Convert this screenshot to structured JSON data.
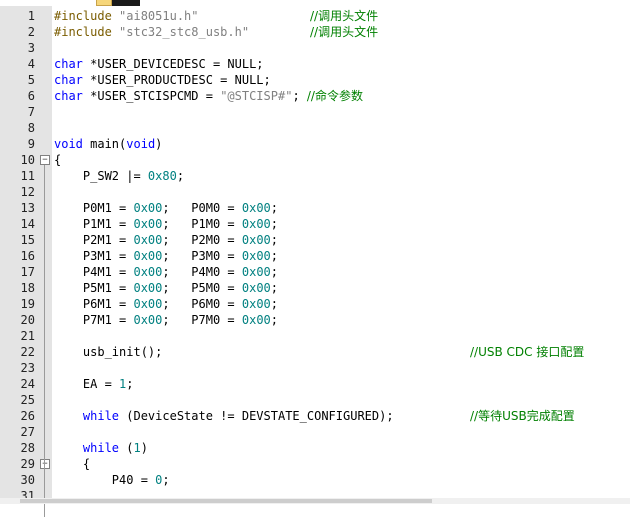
{
  "lines": [
    {
      "n": "1",
      "code": "",
      "parts": [
        {
          "t": "#include ",
          "c": "pp"
        },
        {
          "t": "\"ai8051u.h\"",
          "c": "str"
        }
      ],
      "comment": "//调用头文件"
    },
    {
      "n": "2",
      "code": "",
      "parts": [
        {
          "t": "#include ",
          "c": "pp"
        },
        {
          "t": "\"stc32_stc8_usb.h\"",
          "c": "str"
        }
      ],
      "comment": "//调用头文件"
    },
    {
      "n": "3",
      "parts": []
    },
    {
      "n": "4",
      "parts": [
        {
          "t": "char",
          "c": "kw"
        },
        {
          "t": " *USER_DEVICEDESC = NULL;",
          "c": ""
        }
      ]
    },
    {
      "n": "5",
      "parts": [
        {
          "t": "char",
          "c": "kw"
        },
        {
          "t": " *USER_PRODUCTDESC = NULL;",
          "c": ""
        }
      ]
    },
    {
      "n": "6",
      "parts": [
        {
          "t": "char",
          "c": "kw"
        },
        {
          "t": " *USER_STCISPCMD = ",
          "c": ""
        },
        {
          "t": "\"@STCISP#\"",
          "c": "str"
        },
        {
          "t": "; ",
          "c": ""
        },
        {
          "t": "//命令参数",
          "c": "cmt"
        }
      ]
    },
    {
      "n": "7",
      "parts": []
    },
    {
      "n": "8",
      "parts": []
    },
    {
      "n": "9",
      "parts": [
        {
          "t": "void",
          "c": "kw"
        },
        {
          "t": " main(",
          "c": ""
        },
        {
          "t": "void",
          "c": "kw"
        },
        {
          "t": ")",
          "c": ""
        }
      ]
    },
    {
      "n": "10",
      "fold": "−",
      "parts": [
        {
          "t": "{",
          "c": ""
        }
      ]
    },
    {
      "n": "11",
      "parts": [
        {
          "t": "    P_SW2 |= ",
          "c": ""
        },
        {
          "t": "0x80",
          "c": "num"
        },
        {
          "t": ";",
          "c": ""
        }
      ]
    },
    {
      "n": "12",
      "parts": []
    },
    {
      "n": "13",
      "parts": [
        {
          "t": "    P0M1 = ",
          "c": ""
        },
        {
          "t": "0x00",
          "c": "num"
        },
        {
          "t": ";   P0M0 = ",
          "c": ""
        },
        {
          "t": "0x00",
          "c": "num"
        },
        {
          "t": ";",
          "c": ""
        }
      ]
    },
    {
      "n": "14",
      "parts": [
        {
          "t": "    P1M1 = ",
          "c": ""
        },
        {
          "t": "0x00",
          "c": "num"
        },
        {
          "t": ";   P1M0 = ",
          "c": ""
        },
        {
          "t": "0x00",
          "c": "num"
        },
        {
          "t": ";",
          "c": ""
        }
      ]
    },
    {
      "n": "15",
      "parts": [
        {
          "t": "    P2M1 = ",
          "c": ""
        },
        {
          "t": "0x00",
          "c": "num"
        },
        {
          "t": ";   P2M0 = ",
          "c": ""
        },
        {
          "t": "0x00",
          "c": "num"
        },
        {
          "t": ";",
          "c": ""
        }
      ]
    },
    {
      "n": "16",
      "parts": [
        {
          "t": "    P3M1 = ",
          "c": ""
        },
        {
          "t": "0x00",
          "c": "num"
        },
        {
          "t": ";   P3M0 = ",
          "c": ""
        },
        {
          "t": "0x00",
          "c": "num"
        },
        {
          "t": ";",
          "c": ""
        }
      ]
    },
    {
      "n": "17",
      "parts": [
        {
          "t": "    P4M1 = ",
          "c": ""
        },
        {
          "t": "0x00",
          "c": "num"
        },
        {
          "t": ";   P4M0 = ",
          "c": ""
        },
        {
          "t": "0x00",
          "c": "num"
        },
        {
          "t": ";",
          "c": ""
        }
      ]
    },
    {
      "n": "18",
      "parts": [
        {
          "t": "    P5M1 = ",
          "c": ""
        },
        {
          "t": "0x00",
          "c": "num"
        },
        {
          "t": ";   P5M0 = ",
          "c": ""
        },
        {
          "t": "0x00",
          "c": "num"
        },
        {
          "t": ";",
          "c": ""
        }
      ]
    },
    {
      "n": "19",
      "parts": [
        {
          "t": "    P6M1 = ",
          "c": ""
        },
        {
          "t": "0x00",
          "c": "num"
        },
        {
          "t": ";   P6M0 = ",
          "c": ""
        },
        {
          "t": "0x00",
          "c": "num"
        },
        {
          "t": ";",
          "c": ""
        }
      ]
    },
    {
      "n": "20",
      "parts": [
        {
          "t": "    P7M1 = ",
          "c": ""
        },
        {
          "t": "0x00",
          "c": "num"
        },
        {
          "t": ";   P7M0 = ",
          "c": ""
        },
        {
          "t": "0x00",
          "c": "num"
        },
        {
          "t": ";",
          "c": ""
        }
      ]
    },
    {
      "n": "21",
      "parts": []
    },
    {
      "n": "22",
      "parts": [
        {
          "t": "    usb_init();",
          "c": ""
        }
      ],
      "comment": "//USB CDC 接口配置"
    },
    {
      "n": "23",
      "parts": []
    },
    {
      "n": "24",
      "parts": [
        {
          "t": "    EA = ",
          "c": ""
        },
        {
          "t": "1",
          "c": "num"
        },
        {
          "t": ";",
          "c": ""
        }
      ]
    },
    {
      "n": "25",
      "parts": []
    },
    {
      "n": "26",
      "parts": [
        {
          "t": "    ",
          "c": ""
        },
        {
          "t": "while",
          "c": "kw"
        },
        {
          "t": " (DeviceState != DEVSTATE_CONFIGURED);",
          "c": ""
        }
      ],
      "comment": "//等待USB完成配置"
    },
    {
      "n": "27",
      "parts": []
    },
    {
      "n": "28",
      "parts": [
        {
          "t": "    ",
          "c": ""
        },
        {
          "t": "while",
          "c": "kw"
        },
        {
          "t": " (",
          "c": ""
        },
        {
          "t": "1",
          "c": "num"
        },
        {
          "t": ")",
          "c": ""
        }
      ]
    },
    {
      "n": "29",
      "fold": "−",
      "parts": [
        {
          "t": "    {",
          "c": ""
        }
      ]
    },
    {
      "n": "30",
      "parts": [
        {
          "t": "        P40 = ",
          "c": ""
        },
        {
          "t": "0",
          "c": "num"
        },
        {
          "t": ";",
          "c": ""
        }
      ]
    },
    {
      "n": "31",
      "parts": []
    }
  ],
  "colors": {
    "keyword": "#0000ff",
    "string": "#808080",
    "number": "#008080",
    "comment": "#008000",
    "gutter": "#e4e4e4"
  }
}
